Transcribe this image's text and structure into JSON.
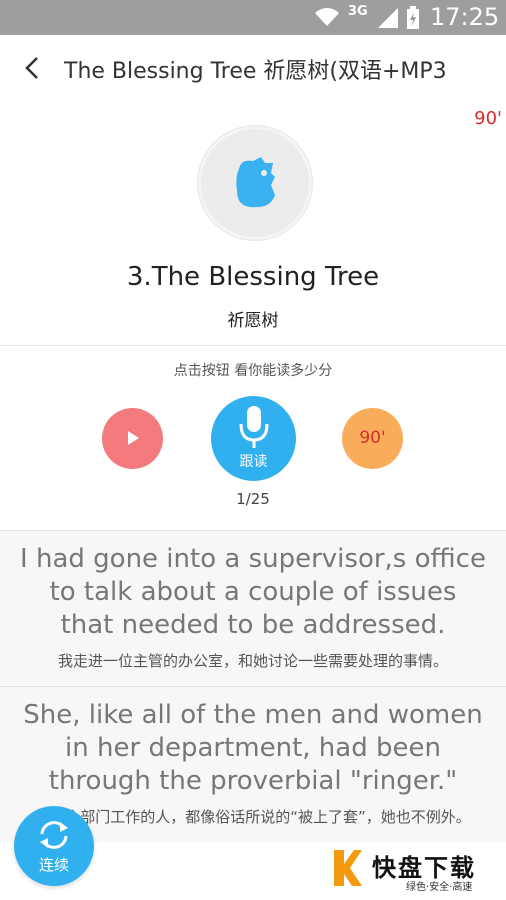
{
  "status_bar": {
    "network": "3G",
    "time": "17:25"
  },
  "header": {
    "title": "The Blessing Tree 祈愿树(双语+MP3"
  },
  "top_score": "90'",
  "lesson": {
    "title": "3.The Blessing Tree",
    "subtitle": "祈愿树",
    "hint": "点击按钮 看你能读多少分",
    "record_label": "跟读",
    "score_badge": "90'",
    "progress": "1/25"
  },
  "sentences": [
    {
      "en": "I had gone into a supervisor,s office to talk about a couple of issues that needed to be addressed.",
      "cn": "我走进一位主管的办公室，和她讨论一些需要处理的事情。"
    },
    {
      "en": "She, like all of the men and women in her department, had been through the proverbial \"ringer.\"",
      "cn": "在这个部门工作的人，都像俗话所说的“被上了套”，她也不例外。"
    }
  ],
  "continuous_label": "连续",
  "watermark": {
    "name": "快盘下载",
    "tagline": "绿色·安全·高速"
  },
  "colors": {
    "accent_blue": "#31b0f0",
    "play_red": "#f47a7e",
    "score_orange": "#f9ad5a",
    "score_text": "#d32f2f"
  }
}
